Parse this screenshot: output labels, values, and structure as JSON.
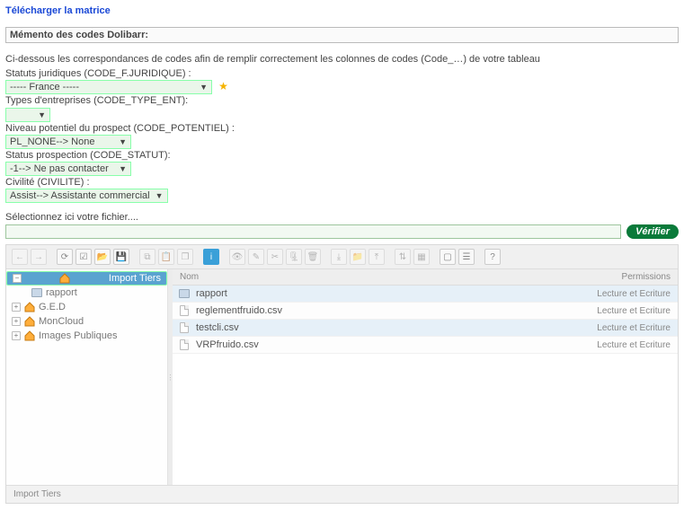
{
  "top_link": "Télécharger la matrice",
  "memento_title": "Mémento des codes Dolibarr:",
  "intro": "Ci-dessous les correspondances de codes afin de remplir correctement les colonnes de codes (Code_…) de votre tableau",
  "form": {
    "status_juridique_label": "Statuts juridiques (CODE_F.JURIDIQUE) :",
    "status_juridique_value": "----- France -----",
    "type_ent_label": "Types d'entreprises (CODE_TYPE_ENT):",
    "niveau_label": "Niveau potentiel du prospect (CODE_POTENTIEL) :",
    "niveau_value": "PL_NONE--> None",
    "status_prosp_label": "Status prospection (CODE_STATUT):",
    "status_prosp_value": "-1--> Ne pas contacter",
    "civilite_label": "Civilité (CIVILITE) :",
    "civilite_value": "Assist--> Assistante commercial"
  },
  "file_picker_label": "Sélectionnez ici votre fichier....",
  "verify_label": "Vérifier",
  "tree": {
    "root_selected": "Import Tiers",
    "root_child": "rapport",
    "items": [
      "G.E.D",
      "MonCloud",
      "Images Publiques"
    ]
  },
  "headers": {
    "name": "Nom",
    "perm": "Permissions"
  },
  "files": [
    {
      "name": "rapport",
      "type": "folder",
      "perm": "Lecture et Ecriture",
      "hl": true
    },
    {
      "name": "reglementfruido.csv",
      "type": "file",
      "perm": "Lecture et Ecriture",
      "hl": false
    },
    {
      "name": "testcli.csv",
      "type": "file",
      "perm": "Lecture et Ecriture",
      "hl": true
    },
    {
      "name": "VRPfruido.csv",
      "type": "file",
      "perm": "Lecture et Ecriture",
      "hl": false
    }
  ],
  "statusbar": "Import Tiers"
}
